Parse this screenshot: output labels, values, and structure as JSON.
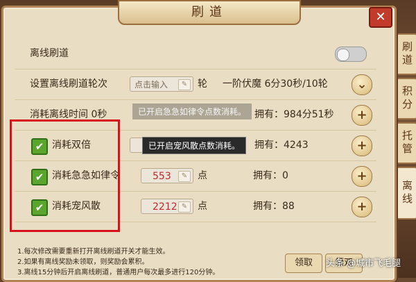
{
  "window": {
    "title": "刷道",
    "close_label": "✕"
  },
  "rows": {
    "offline": {
      "label": "离线刷道",
      "toggle_on": false
    },
    "rounds": {
      "label": "设置离线刷道轮次",
      "input_placeholder": "点击输入",
      "unit": "轮",
      "preset": "一阶伏魔 6分30秒/10轮"
    },
    "time": {
      "label": "消耗离线时间 0秒",
      "owned": "拥有：984分51秒"
    },
    "double": {
      "label": "消耗双倍",
      "owned": "拥有：4243"
    },
    "jiji": {
      "label": "消耗急急如律令",
      "value": "553",
      "unit": "点",
      "owned": "拥有：0"
    },
    "chongfeng": {
      "label": "消耗宠风散",
      "value": "2212",
      "unit": "点",
      "owned": "拥有：88"
    }
  },
  "tooltips": {
    "jiji_faded": "已开启急急如律令点数消耗。",
    "chongfeng": "已开启宠风散点数消耗。"
  },
  "notes": [
    "1.每次修改需要重新打开离线刷道开关才能生效。",
    "2.如果有离线奖励未领取，则奖励会累积。",
    "3.离线15分钟后开启离线刷道，普通用户每次最多进行120分钟。"
  ],
  "buttons": {
    "claim": "领取",
    "claim2": "领双"
  },
  "side_tabs": [
    "刷道",
    "积分",
    "托管",
    "离线"
  ],
  "watermark": "头条 @城市飞毛腿",
  "icons": {
    "check": "✔",
    "plus": "+",
    "chevron_down": "⌄",
    "pencil": "✎"
  },
  "colors": {
    "accent_red": "#d8101c",
    "check_green": "#5aa52e",
    "value_red": "#c0282e"
  }
}
